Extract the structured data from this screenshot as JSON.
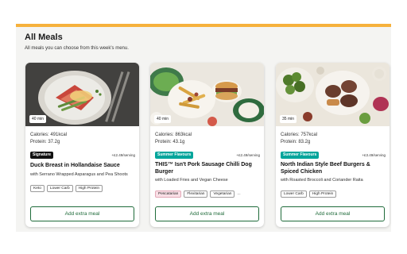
{
  "section": {
    "title": "All Meals",
    "subtitle": "All meals you can choose from this week's menu."
  },
  "colors": {
    "accent_bar": "#f6b13c",
    "button_green": "#1f6b3a",
    "teal_badge": "#00a59b"
  },
  "meals": [
    {
      "time": "40 min",
      "calories": "Calories: 491kcal",
      "protein": "Protein: 37.2g",
      "badge": "Signature",
      "extra_price": "+£2.49/serving",
      "name": "Duck Breast in Hollandaise Sauce",
      "description": "with Serrano Wrapped Asparagus and Pea Shoots",
      "tags": [
        "Keto",
        "Lower Carb",
        "High Protein"
      ],
      "button": "Add extra meal"
    },
    {
      "time": "40 min",
      "calories": "Calories: 863kcal",
      "protein": "Protein: 43.1g",
      "badge": "Summer Flavours",
      "extra_price": "+£2.49/serving",
      "name": "THIS™ Isn't Pork Sausage Chilli Dog Burger",
      "description": "with Loaded Fries and Vegan Cheese",
      "tags": [
        "Pescatarian",
        "Flexitarian",
        "Vegetarian"
      ],
      "more": "...",
      "button": "Add extra meal"
    },
    {
      "time": "35 min",
      "calories": "Calories: 757kcal",
      "protein": "Protein: 83.2g",
      "badge": "Summer Flavours",
      "extra_price": "+£3.49/serving",
      "name": "North Indian Style Beef Burgers & Spiced Chicken",
      "description": "with Roasted Broccoli and Coriander Raita",
      "tags": [
        "Lower Carb",
        "High Protein"
      ],
      "button": "Add extra meal"
    }
  ]
}
